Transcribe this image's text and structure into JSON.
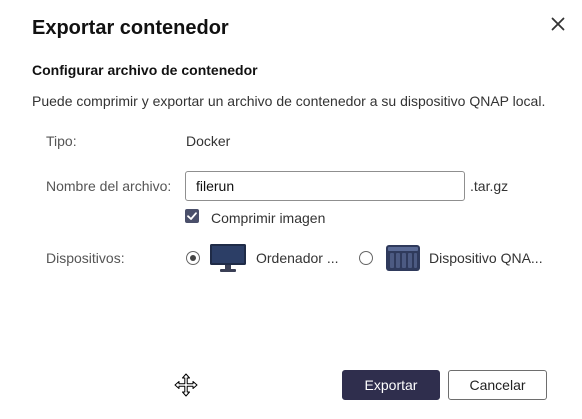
{
  "dialog": {
    "title": "Exportar contenedor",
    "close_icon": "close-icon"
  },
  "section": {
    "title": "Configurar archivo de contenedor",
    "description": "Puede comprimir y exportar un archivo de contenedor a su dispositivo QNAP local."
  },
  "form": {
    "type_label": "Tipo:",
    "type_value": "Docker",
    "filename_label": "Nombre del archivo:",
    "filename_value": "filerun",
    "filename_suffix": ".tar.gz",
    "compress_label": "Comprimir imagen",
    "compress_checked": true,
    "devices_label": "Dispositivos:",
    "devices": [
      {
        "label": "Ordenador ...",
        "selected": true,
        "icon": "monitor-icon"
      },
      {
        "label": "Dispositivo QNA...",
        "selected": false,
        "icon": "nas-device-icon"
      }
    ]
  },
  "buttons": {
    "export_label": "Exportar",
    "cancel_label": "Cancelar"
  },
  "colors": {
    "primary": "#2f2e4d",
    "checkbox": "#4a4f6a",
    "monitor_screen": "#2c3e66"
  },
  "cursor": "move-cursor-icon"
}
